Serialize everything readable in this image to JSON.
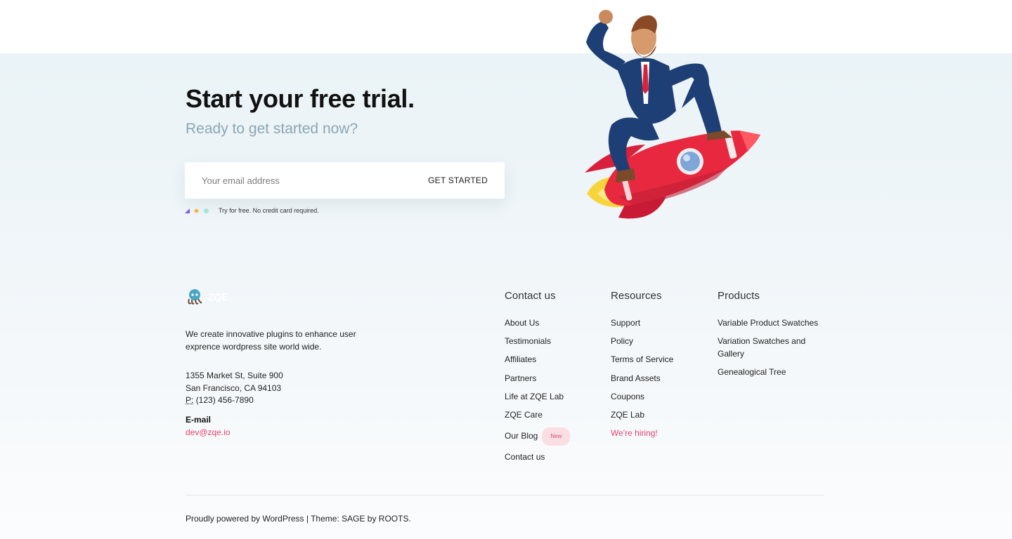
{
  "cta": {
    "title_prefix": "Start your",
    "title_highlight": "free trial.",
    "subtitle": "Ready to get started now?",
    "email_placeholder": "Your email address",
    "button_label": "GET STARTED",
    "note": "Try for free. No credit card required."
  },
  "illustration": {
    "icon": "rocket-businessman-illustration"
  },
  "footer": {
    "brand": {
      "name": "ZQE",
      "icon": "octopus-logo-icon"
    },
    "about": "We create innovative plugins to enhance user exprence wordpress site world wide.",
    "address": {
      "line1": "1355 Market St, Suite 900",
      "line2": "San Francisco, CA 94103",
      "phone_label": "P:",
      "phone": "(123) 456-7890"
    },
    "email_label": "E-mail",
    "email": "dev@zqe.io",
    "columns": {
      "contact": {
        "title": "Contact us",
        "items": [
          "About Us",
          "Testimonials",
          "Affiliates",
          "Partners",
          "Life at ZQE Lab",
          "ZQE Care",
          "Our Blog",
          "Contact us"
        ],
        "badge": "New"
      },
      "resources": {
        "title": "Resources",
        "items": [
          "Support",
          "Policy",
          "Terms of Service",
          "Brand Assets",
          "Coupons",
          "ZQE Lab",
          "We're hiring!"
        ]
      },
      "products": {
        "title": "Products",
        "items": [
          "Variable Product Swatches",
          "Variation Swatches and Gallery",
          "Genealogical Tree"
        ]
      }
    },
    "credits": "Proudly powered by WordPress | Theme: SAGE by ROOTS."
  },
  "colors": {
    "accent": "#e2446a",
    "highlight": "#fbd4df",
    "subtitle": "#8ca6b3",
    "background": "#eaf3f7"
  }
}
